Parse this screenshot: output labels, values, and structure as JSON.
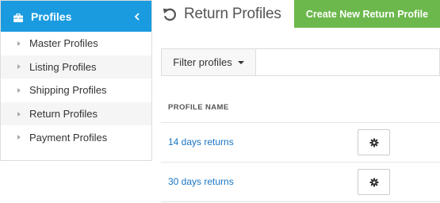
{
  "sidebar": {
    "title": "Profiles",
    "icon": "briefcase-icon",
    "collapse_icon": "chevron-left-icon",
    "accent_color": "#1a9be0",
    "items": [
      {
        "label": "Master Profiles"
      },
      {
        "label": "Listing Profiles"
      },
      {
        "label": "Shipping Profiles"
      },
      {
        "label": "Return Profiles"
      },
      {
        "label": "Payment Profiles"
      }
    ]
  },
  "header": {
    "icon": "undo-icon",
    "title": "Return Profiles",
    "create_button_label": "Create New Return Profile",
    "create_button_color": "#6cb84c"
  },
  "filter": {
    "button_label": "Filter profiles",
    "input_value": ""
  },
  "table": {
    "column_header": "PROFILE NAME",
    "rows": [
      {
        "name": "14 days returns",
        "action_icon": "gear-icon"
      },
      {
        "name": "30 days returns",
        "action_icon": "gear-icon"
      }
    ],
    "link_color": "#1a75c4"
  }
}
